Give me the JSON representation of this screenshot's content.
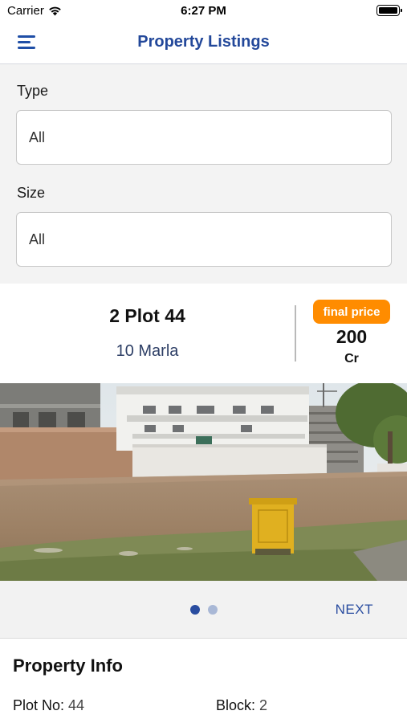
{
  "status": {
    "carrier": "Carrier",
    "time": "6:27 PM"
  },
  "nav": {
    "title": "Property Listings",
    "menu_icon": "hamburger-menu-icon"
  },
  "filters": {
    "type_label": "Type",
    "type_value": "All",
    "size_label": "Size",
    "size_value": "All"
  },
  "listing": {
    "title": "2 Plot 44",
    "size": "10 Marla",
    "price_badge": "final price",
    "price_value": "200",
    "price_unit": "Cr"
  },
  "carousel": {
    "next_label": "NEXT",
    "dot_count": 2,
    "active_index": 0
  },
  "info": {
    "title": "Property Info",
    "plot_no_label": "Plot No:",
    "plot_no_value": "44",
    "block_label": "Block:",
    "block_value": "2"
  },
  "colors": {
    "accent": "#23489a",
    "badge": "#ff8c00"
  }
}
